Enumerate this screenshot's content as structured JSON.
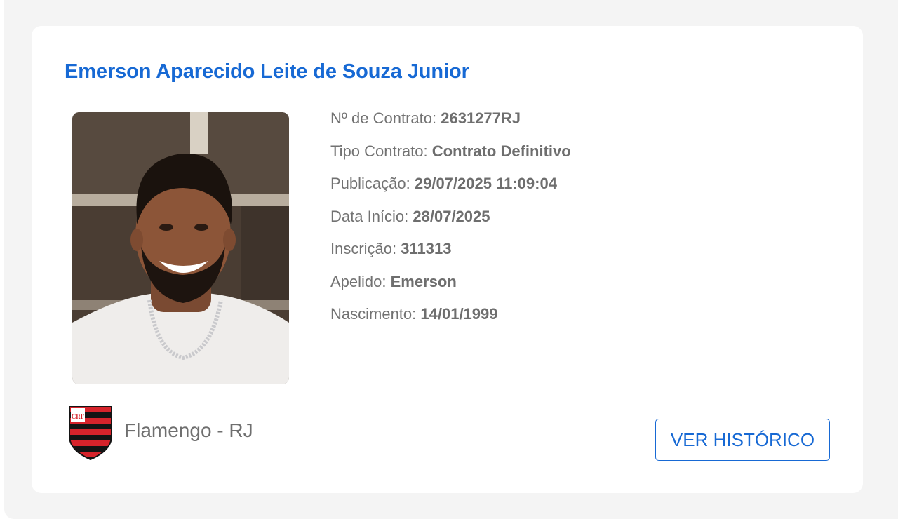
{
  "player": {
    "name": "Emerson Aparecido Leite de Souza Junior",
    "fields": [
      {
        "label": "Nº de Contrato: ",
        "value": "2631277RJ"
      },
      {
        "label": "Tipo Contrato: ",
        "value": "Contrato Definitivo"
      },
      {
        "label": "Publicação: ",
        "value": "29/07/2025 11:09:04"
      },
      {
        "label": "Data Início: ",
        "value": "28/07/2025"
      },
      {
        "label": "Inscrição: ",
        "value": "311313"
      },
      {
        "label": "Apelido: ",
        "value": "Emerson"
      },
      {
        "label": "Nascimento: ",
        "value": "14/01/1999"
      }
    ],
    "photo_icon": "player-photo"
  },
  "club": {
    "name": "Flamengo - RJ",
    "crest_icon": "flamengo-crest-icon",
    "crest_text": "CRF",
    "colors": {
      "red": "#d6232b",
      "black": "#141414"
    }
  },
  "actions": {
    "history_label": "VER HISTÓRICO"
  },
  "theme": {
    "accent": "#1769d4",
    "text": "#727272",
    "background": "#f4f4f4",
    "card": "#ffffff"
  }
}
